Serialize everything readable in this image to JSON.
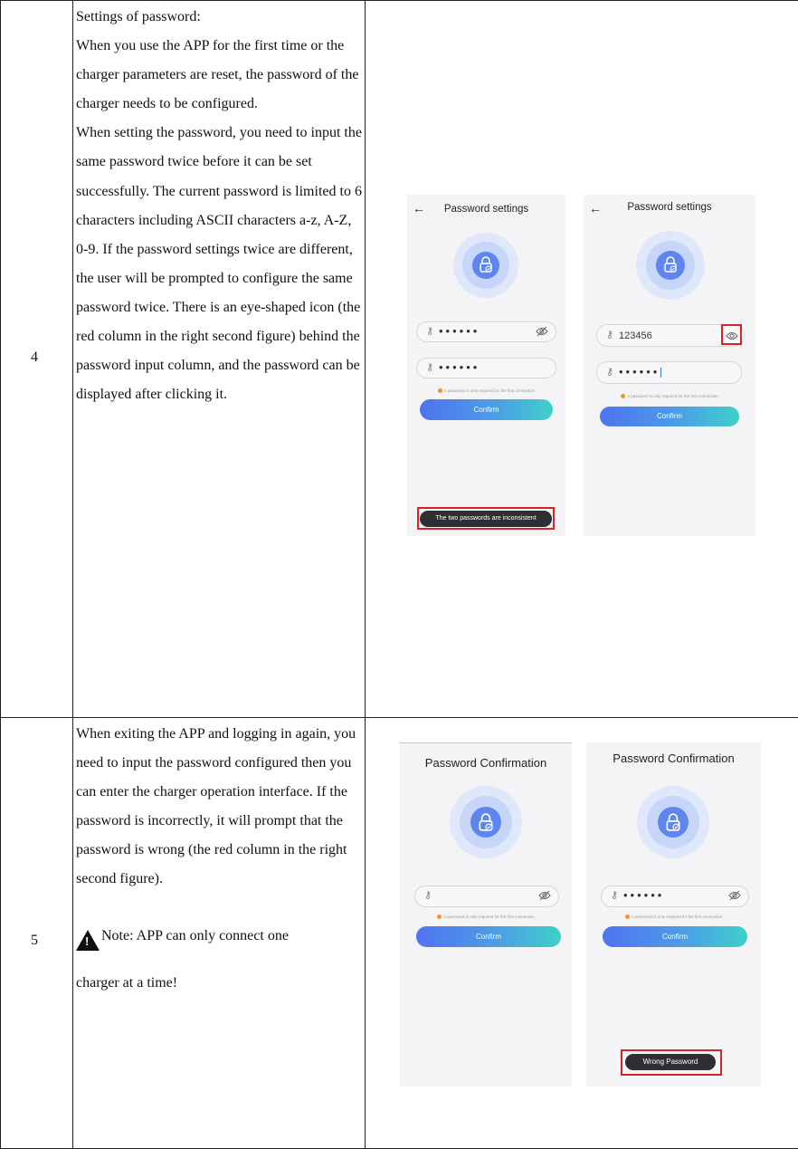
{
  "rows": [
    {
      "number": "4",
      "paragraphs": [
        "Settings of password:",
        "When you use the APP for the first time or the charger parameters are reset, the password of the charger needs to be configured.",
        "When setting the password, you need to input the same password twice before it can be set successfully. The current password is limited to 6 characters including ASCII characters a-z, A-Z, 0-9. If the password settings twice are different, the user will be prompted to configure the same password twice. There is an eye-shaped icon (the red column in the right second figure) behind the password input column, and the password can be displayed after clicking it."
      ],
      "screens": [
        {
          "back_arrow": "←",
          "title": "Password settings",
          "field1_value": "••••••",
          "field2_value": "••••••",
          "hint": "A password is only required for the first connection",
          "confirm_label": "Confirm",
          "toast": "The two passwords are inconsistent"
        },
        {
          "back_arrow": "←",
          "title": "Password settings",
          "field1_value": "123456",
          "field2_value": "••••••",
          "hint": "A password is only required for the first connection",
          "confirm_label": "Confirm"
        }
      ]
    },
    {
      "number": "5",
      "paragraphs": [
        "When exiting the APP and logging in again, you need to input the password configured then you can enter the charger operation interface. If the password is incorrectly, it will prompt that the password is wrong (the red column in the right second figure)."
      ],
      "note_text": "Note: APP can only connect one",
      "note_text_2": "charger at a time!",
      "screens": [
        {
          "title": "Password Confirmation",
          "field_value": "",
          "hint": "A password is only required for the first connection",
          "confirm_label": "Confirm"
        },
        {
          "title": "Password Confirmation",
          "field_value": "••••••",
          "hint": "A password is only required for the first connection",
          "confirm_label": "Confirm",
          "toast": "Wrong Password"
        }
      ]
    }
  ],
  "colors": {
    "highlight_box": "#d62424",
    "primary_button_start": "#4f73ef",
    "primary_button_end": "#3fd0c9",
    "lock_icon_fill": "#5e86ee",
    "hint_bullet": "#f0922c"
  },
  "icons": [
    "back-arrow-icon",
    "lock-check-icon",
    "key-icon",
    "eye-off-icon",
    "eye-icon",
    "warning-icon"
  ]
}
